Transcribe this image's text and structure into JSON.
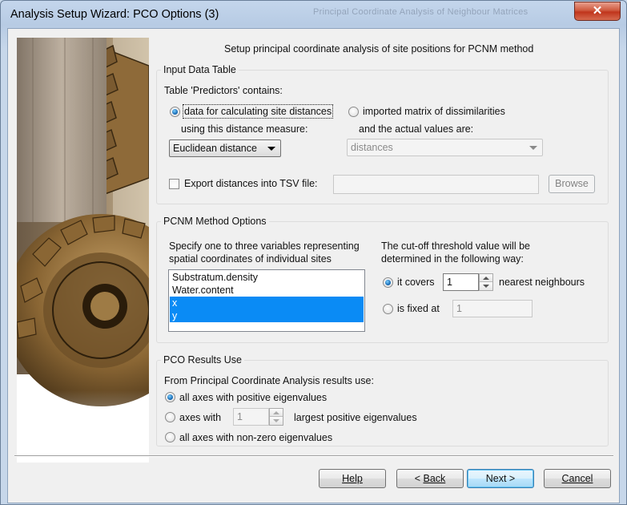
{
  "window": {
    "title": "Analysis Setup Wizard: PCO Options (3)",
    "background_title_ghost": "Principal Coordinate Analysis of Neighbour Matrices",
    "close_glyph": "✕"
  },
  "subtitle": "Setup principal coordinate analysis of site positions for PCNM method",
  "input_group": {
    "label": "Input Data Table",
    "table_text": "Table 'Predictors' contains:",
    "option_site": "data for calculating site distances",
    "option_site_sub": "using this distance measure:",
    "option_matrix": "imported matrix of dissimilarities",
    "option_matrix_sub": "and the actual values are:",
    "distance_measure": "Euclidean distance",
    "values_select": "distances",
    "export_label": "Export distances into TSV file:",
    "export_path": "",
    "browse_label": "Browse"
  },
  "pcnm_group": {
    "label": "PCNM Method Options",
    "spec_line1": "Specify one to three variables representing",
    "spec_line2": "spatial coordinates of individual sites",
    "variables": [
      {
        "label": "Substratum.density",
        "selected": false
      },
      {
        "label": "Water.content",
        "selected": false
      },
      {
        "label": "x",
        "selected": true
      },
      {
        "label": "y",
        "selected": true
      }
    ],
    "cutoff_line1": "The cut-off threshold value will be",
    "cutoff_line2": "determined in the following way:",
    "option_covers": "it covers",
    "covers_value": "1",
    "covers_suffix": "nearest neighbours",
    "option_fixed": "is fixed at",
    "fixed_value": "1"
  },
  "pco_group": {
    "label": "PCO Results Use",
    "intro": "From Principal Coordinate Analysis results use:",
    "option_positive": "all axes with positive eigenvalues",
    "option_axes_with": "axes with",
    "axes_value": "1",
    "axes_suffix": "largest positive eigenvalues",
    "option_nonzero": "all axes with non-zero eigenvalues"
  },
  "buttons": {
    "help": "Help",
    "back_prefix": "< ",
    "back": "Back",
    "next": "Next >",
    "cancel": "Cancel"
  },
  "colors": {
    "selection": "#0a8bf5",
    "titlebar": "#b9cde5",
    "close_button": "#c9482f"
  },
  "icons": {
    "close": "close-icon",
    "dropdown": "chevron-down-icon",
    "spinner": "spin-arrows-icon",
    "side_image": "gear-wheel-image"
  }
}
